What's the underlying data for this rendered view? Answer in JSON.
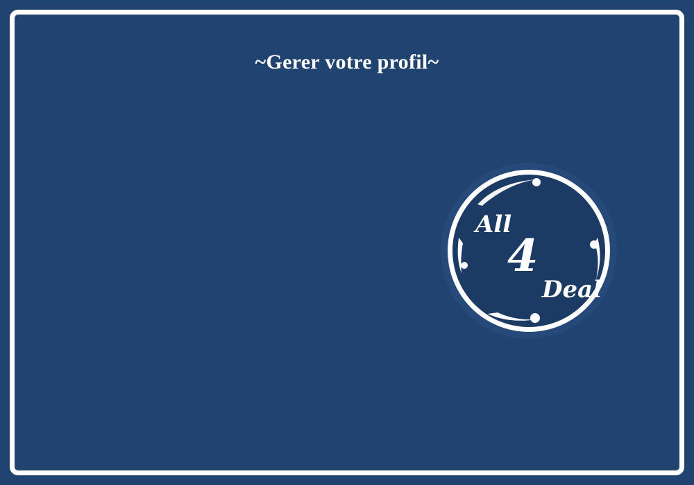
{
  "page": {
    "title": "~Gerer votre profil~"
  },
  "logo": {
    "word_all": "All",
    "word_four": "4",
    "word_deal": "Deal"
  },
  "colors": {
    "background": "#20436f",
    "frame": "#ffffff",
    "logo_inner": "#1b3a64"
  }
}
